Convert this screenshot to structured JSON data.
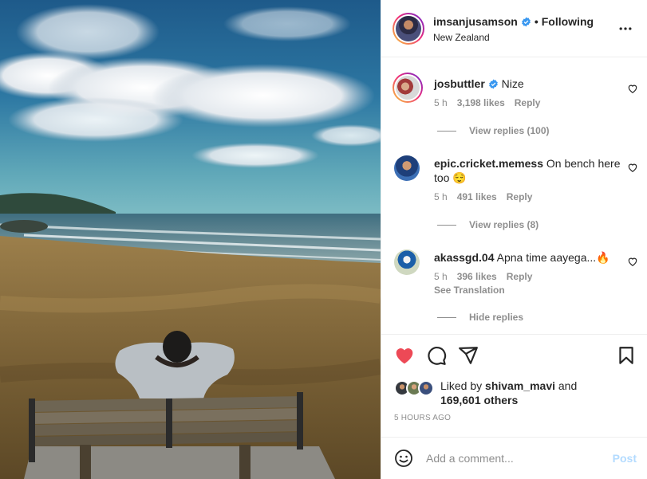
{
  "header": {
    "username": "imsanjusamson",
    "separator": "•",
    "follow_status": "Following",
    "location": "New Zealand",
    "more_icon": "more-horizontal-icon"
  },
  "comments": [
    {
      "username": "josbuttler",
      "verified": true,
      "text": "Nize",
      "time": "5 h",
      "likes": "3,198 likes",
      "reply": "Reply",
      "replies_toggle": "View replies (100)"
    },
    {
      "username": "epic.cricket.memess",
      "verified": false,
      "text": "On bench here too",
      "emoji": "😌",
      "time": "5 h",
      "likes": "491 likes",
      "reply": "Reply",
      "replies_toggle": "View replies (8)"
    },
    {
      "username": "akassgd.04",
      "verified": false,
      "text": "Apna time aayega...",
      "emoji": "🔥",
      "time": "5 h",
      "likes": "396 likes",
      "reply": "Reply",
      "translation": "See Translation",
      "replies_toggle": "Hide replies"
    }
  ],
  "actions": {
    "like_icon": "heart-filled-icon",
    "comment_icon": "comment-icon",
    "share_icon": "share-icon",
    "save_icon": "bookmark-icon",
    "like_color": "#ed4956"
  },
  "likes": {
    "prefix": "Liked by",
    "user": "shivam_mavi",
    "joiner": "and",
    "others": "169,601 others"
  },
  "timestamp": "5 HOURS AGO",
  "add_comment": {
    "placeholder": "Add a comment...",
    "post_label": "Post",
    "emoji_icon": "smiley-icon"
  },
  "colors": {
    "verified_blue": "#3897f0",
    "post_disabled": "#b3dbff",
    "muted_text": "#8e8e8e"
  }
}
